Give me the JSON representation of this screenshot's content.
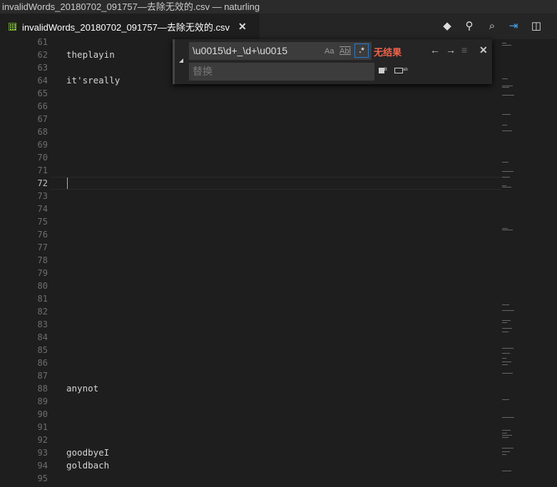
{
  "window": {
    "title": "invalidWords_20180702_091757—去除无效的.csv — naturling"
  },
  "tab": {
    "label": "invalidWords_20180702_091757—去除无效的.csv",
    "close": "✕"
  },
  "toolbar": {
    "icons": [
      "git-icon",
      "open-preview-icon",
      "find-in-files-icon",
      "open-changes-icon",
      "split-editor-icon"
    ]
  },
  "editor": {
    "current_line": 72,
    "lines": [
      {
        "n": "61",
        "t": ""
      },
      {
        "n": "62",
        "t": "theplayin"
      },
      {
        "n": "63",
        "t": ""
      },
      {
        "n": "64",
        "t": "it'sreally"
      },
      {
        "n": "65",
        "t": ""
      },
      {
        "n": "66",
        "t": ""
      },
      {
        "n": "67",
        "t": ""
      },
      {
        "n": "68",
        "t": ""
      },
      {
        "n": "69",
        "t": ""
      },
      {
        "n": "70",
        "t": ""
      },
      {
        "n": "71",
        "t": ""
      },
      {
        "n": "72",
        "t": ""
      },
      {
        "n": "73",
        "t": ""
      },
      {
        "n": "74",
        "t": ""
      },
      {
        "n": "75",
        "t": ""
      },
      {
        "n": "76",
        "t": ""
      },
      {
        "n": "77",
        "t": ""
      },
      {
        "n": "78",
        "t": ""
      },
      {
        "n": "79",
        "t": ""
      },
      {
        "n": "80",
        "t": ""
      },
      {
        "n": "81",
        "t": ""
      },
      {
        "n": "82",
        "t": ""
      },
      {
        "n": "83",
        "t": ""
      },
      {
        "n": "84",
        "t": ""
      },
      {
        "n": "85",
        "t": ""
      },
      {
        "n": "86",
        "t": ""
      },
      {
        "n": "87",
        "t": ""
      },
      {
        "n": "88",
        "t": "anynot"
      },
      {
        "n": "89",
        "t": ""
      },
      {
        "n": "90",
        "t": ""
      },
      {
        "n": "91",
        "t": ""
      },
      {
        "n": "92",
        "t": ""
      },
      {
        "n": "93",
        "t": "goodbyeI"
      },
      {
        "n": "94",
        "t": "goldbach"
      },
      {
        "n": "95",
        "t": ""
      }
    ]
  },
  "find": {
    "value": "\\u0015\\d+_\\d+\\u0015",
    "match_case": "Aa",
    "whole_word": "Abl",
    "regex": ".*",
    "status": "无结果",
    "prev": "←",
    "next": "→",
    "close": "✕",
    "replace_placeholder": "替换",
    "replace_one": "ᴮ",
    "replace_all": "ᵃᵇ"
  }
}
